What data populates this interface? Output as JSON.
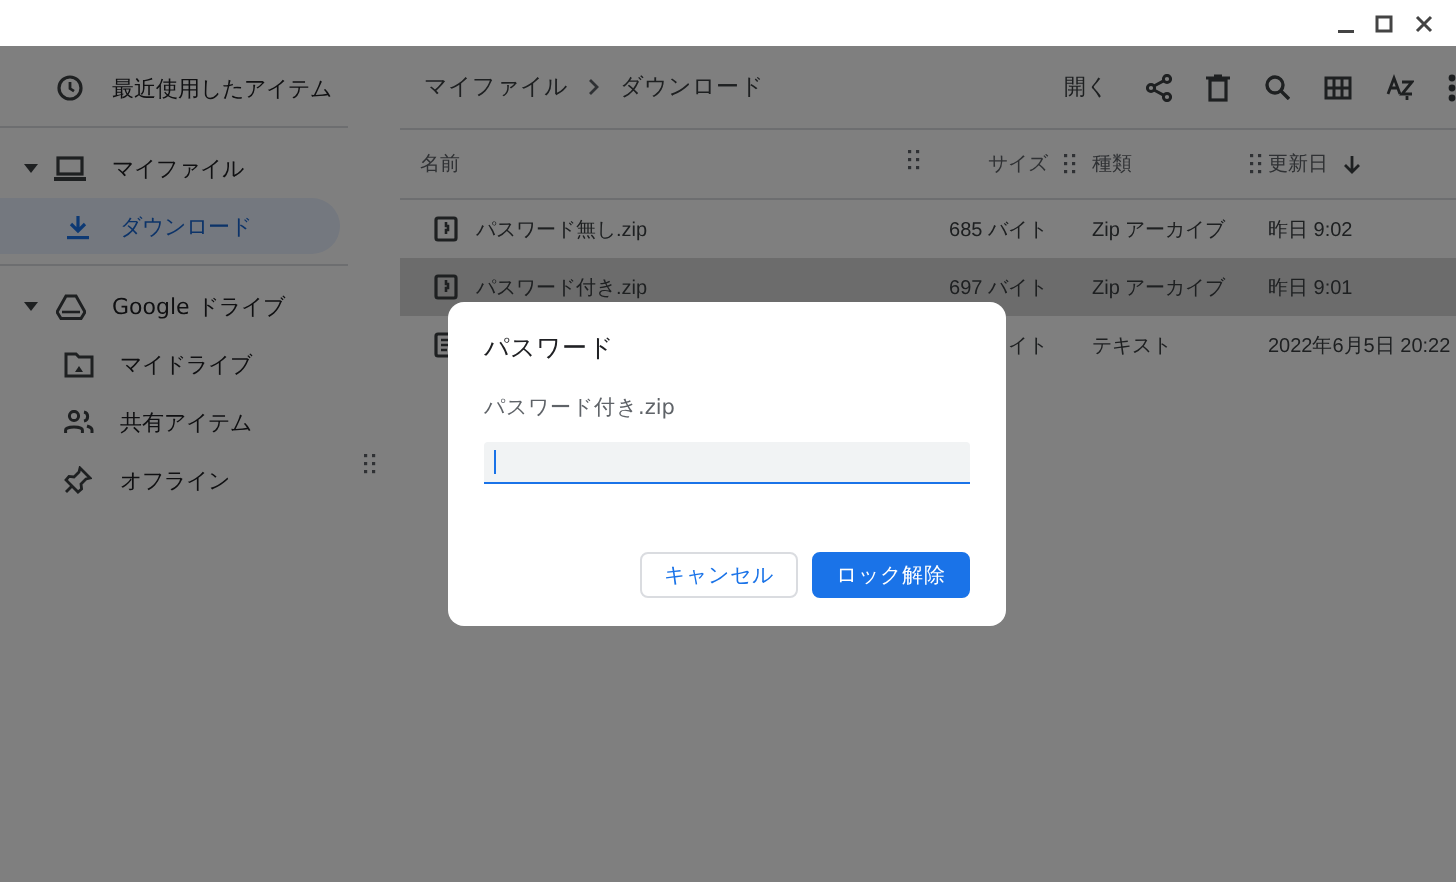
{
  "sidebar": {
    "items": [
      {
        "label": "最近使用したアイテム",
        "selected": false
      },
      {
        "label": "マイファイル",
        "selected": false,
        "expanded": true,
        "children": [
          {
            "label": "ダウンロード",
            "selected": true
          }
        ]
      },
      {
        "label": "Google ドライブ",
        "selected": false,
        "expanded": true,
        "children": [
          {
            "label": "マイドライブ",
            "selected": false
          },
          {
            "label": "共有アイテム",
            "selected": false
          },
          {
            "label": "オフライン",
            "selected": false
          }
        ]
      }
    ]
  },
  "breadcrumb": [
    "マイファイル",
    "ダウンロード"
  ],
  "toolbar": {
    "open_button": "開く"
  },
  "table": {
    "columns": [
      {
        "label": "名前"
      },
      {
        "label": "サイズ"
      },
      {
        "label": "種類"
      },
      {
        "label": "更新日",
        "sorted": true
      }
    ],
    "rows": [
      {
        "kind": "zip",
        "name": "パスワード無し.zip",
        "size": "685 バイト",
        "type": "Zip アーカイブ",
        "modified": "昨日 9:02",
        "selected": false
      },
      {
        "kind": "zip",
        "name": "パスワード付き.zip",
        "size": "697 バイト",
        "type": "Zip アーカイブ",
        "modified": "昨日 9:01",
        "selected": true
      },
      {
        "kind": "text",
        "size": "イト",
        "type": "テキスト",
        "modified": "2022年6月5日 20:22",
        "selected": false
      }
    ]
  },
  "dialog": {
    "title": "パスワード",
    "filename": "パスワード付き.zip",
    "buttons": [
      {
        "label": "キャンセル",
        "kind": "secondary"
      },
      {
        "label": "ロック解除",
        "kind": "primary"
      }
    ]
  }
}
